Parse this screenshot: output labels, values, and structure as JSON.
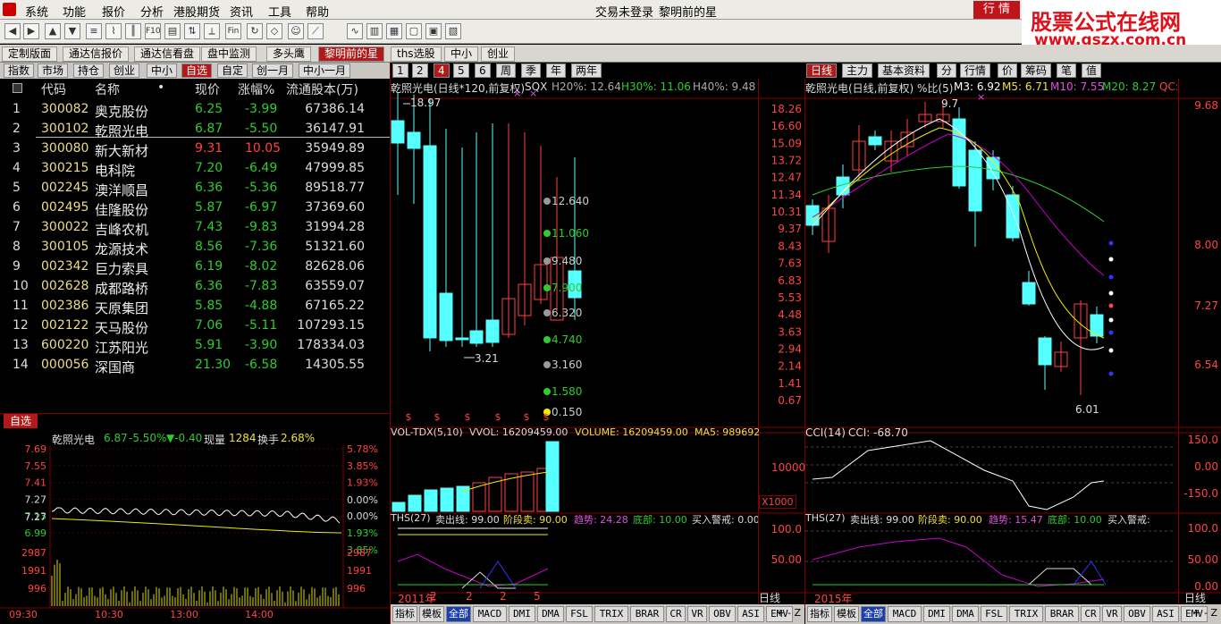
{
  "menu": {
    "items": [
      "系统",
      "功能",
      "报价",
      "分析",
      "港股期货",
      "资讯",
      "工具",
      "帮助"
    ],
    "status": "交易未登录",
    "title": "黎明前的星",
    "quote_btn": "行 情"
  },
  "watermark": {
    "line1": "股票公式在线网",
    "line2": "www.gszx.com.cn"
  },
  "tabs1": [
    "定制版面",
    "通达信报价",
    "通达信看盘",
    "盘中监测",
    "多头鹰",
    "黎明前的星",
    "ths选股",
    "中小",
    "创业"
  ],
  "tabs2": [
    "指数",
    "市场",
    "持仓",
    "创业",
    "中小",
    "自选",
    "自定",
    "创一月",
    "中小一月"
  ],
  "period_tabs": [
    "1",
    "2",
    "4",
    "5",
    "6",
    "周",
    "季",
    "年",
    "两年"
  ],
  "right_tabs": [
    "日线",
    "主力",
    "基本资料",
    "分",
    "行情",
    "价",
    "筹码",
    "笔",
    "值"
  ],
  "list_header": {
    "code": "代码",
    "name": "名称",
    "dot": "•",
    "price": "现价",
    "chg": "涨幅%",
    "cap": "流通股本(万)"
  },
  "stocks": [
    {
      "n": "1",
      "code": "300082",
      "name": "奥克股份",
      "price": "6.25",
      "chg": "-3.99",
      "cap": "67386.14"
    },
    {
      "n": "2",
      "code": "300102",
      "name": "乾照光电",
      "price": "6.87",
      "chg": "-5.50",
      "cap": "36147.91"
    },
    {
      "n": "3",
      "code": "300080",
      "name": "新大新材",
      "price": "9.31",
      "chg": "10.05",
      "cap": "35949.89"
    },
    {
      "n": "4",
      "code": "300215",
      "name": "电科院",
      "price": "7.20",
      "chg": "-6.49",
      "cap": "47999.85"
    },
    {
      "n": "5",
      "code": "002245",
      "name": "澳洋顺昌",
      "price": "6.36",
      "chg": "-5.36",
      "cap": "89518.77"
    },
    {
      "n": "6",
      "code": "002495",
      "name": "佳隆股份",
      "price": "5.87",
      "chg": "-6.97",
      "cap": "37369.60"
    },
    {
      "n": "7",
      "code": "300022",
      "name": "吉峰农机",
      "price": "7.43",
      "chg": "-9.83",
      "cap": "31994.28"
    },
    {
      "n": "8",
      "code": "300105",
      "name": "龙源技术",
      "price": "8.56",
      "chg": "-7.36",
      "cap": "51321.60"
    },
    {
      "n": "9",
      "code": "002342",
      "name": "巨力索具",
      "price": "6.19",
      "chg": "-8.02",
      "cap": "82628.06"
    },
    {
      "n": "10",
      "code": "002628",
      "name": "成都路桥",
      "price": "6.36",
      "chg": "-7.83",
      "cap": "63559.07"
    },
    {
      "n": "11",
      "code": "002386",
      "name": "天原集团",
      "price": "5.85",
      "chg": "-4.88",
      "cap": "67165.22"
    },
    {
      "n": "12",
      "code": "002122",
      "name": "天马股份",
      "price": "7.06",
      "chg": "-5.11",
      "cap": "107293.15"
    },
    {
      "n": "13",
      "code": "600220",
      "name": "江苏阳光",
      "price": "5.91",
      "chg": "-3.90",
      "cap": "178334.03"
    },
    {
      "n": "14",
      "code": "000056",
      "name": "深国商",
      "price": "21.30",
      "chg": "-6.58",
      "cap": "14305.55"
    }
  ],
  "zixuan": "自选",
  "mini": {
    "name": "乾照光电",
    "price": "6.87",
    "chg": "-5.50%",
    "delta": "▼-0.40",
    "vol_label": "现量",
    "vol": "1284",
    "turn_label": "换手",
    "turn": "2.68%",
    "left_axis": [
      "7.69",
      "7.55",
      "7.41",
      "7.27",
      "7.13",
      "6.99"
    ],
    "right_axis": [
      "5.78%",
      "3.85%",
      "1.93%",
      "0.00%",
      "1.93%",
      "3.85%"
    ],
    "vol_axis": [
      "2987",
      "1991",
      "996"
    ],
    "times": [
      "09:30",
      "10:30",
      "13:00",
      "14:00"
    ]
  },
  "mid": {
    "title": "乾照光电(日线*120,前复权)",
    "sqx": "SQX",
    "h20": "H20%: 12.64",
    "h30": "H30%: 11.06",
    "h40": "H40%: 9.48",
    "axis": [
      "18.26",
      "16.60",
      "15.09",
      "13.72",
      "12.47",
      "11.34",
      "10.31",
      "9.37",
      "8.43",
      "7.63",
      "6.83",
      "5.53",
      "4.48",
      "3.63",
      "2.94",
      "2.14",
      "1.41",
      "0.67"
    ],
    "hi": "18.97",
    "lo": "3.21",
    "levels": [
      "12.640",
      "11.060",
      "9.480",
      "7.900",
      "6.320",
      "4.740",
      "3.160",
      "1.580",
      "0.150"
    ],
    "vol_title": "VOL-TDX(5,10)",
    "vol_v": "VVOL: 16209459.00",
    "vol_vol": "VOLUME: 16209459.00",
    "vol_ma5": "MA5: 989692",
    "vol_axis": "10000",
    "x1000": "X1000",
    "ths_title": "THS(27)",
    "ths_a": "卖出线: 99.00",
    "ths_b": "阶段卖: 90.00",
    "ths_c": "趋势: 24.28",
    "ths_d": "底部: 10.00",
    "ths_e": "买入警戒: 0.00",
    "year": "2011年",
    "marks": [
      "2",
      "2",
      "2",
      "5"
    ],
    "period": "日线*120"
  },
  "right": {
    "title": "乾照光电(日线,前复权) %比(5)",
    "m3": "M3: 6.92",
    "m5": "M5: 6.71",
    "m10": "M10: 7.55",
    "m20": "M20: 8.27",
    "qc": "QC: 7",
    "axis": [
      "9.68",
      "8.00",
      "7.27",
      "6.54"
    ],
    "hi": "9.7",
    "lo": "6.01",
    "cci_title": "CCI(14)",
    "cci_v": "CCI: -68.70",
    "cci_axis": [
      "150.0",
      "0.00",
      "-150.0"
    ],
    "ths_title": "THS(27)",
    "ths_a": "卖出线: 99.00",
    "ths_b": "阶段卖: 90.00",
    "ths_c": "趋势: 15.47",
    "ths_d": "底部: 10.00",
    "ths_e": "买入警戒:",
    "ths_axis": [
      "100.0",
      "50.00",
      "0.00"
    ],
    "year": "2015年",
    "period": "日线",
    "axis_100": "100.0",
    "axis_50": "50.00"
  },
  "bottom_tabs": [
    "指标",
    "模板",
    "全部",
    "MACD",
    "DMI",
    "DMA",
    "FSL",
    "TRIX",
    "BRAR",
    "CR",
    "VR",
    "OBV",
    "ASI",
    "EMV"
  ]
}
